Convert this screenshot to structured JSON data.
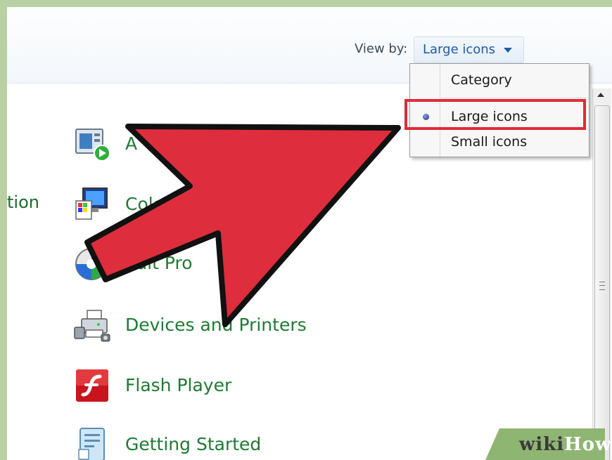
{
  "toolbar": {
    "view_by_label": "View by:",
    "view_by_value": "Large icons"
  },
  "left_partial_label": "tion",
  "items": [
    {
      "label": "A",
      "icon": "action-center-icon"
    },
    {
      "label": "Colo",
      "icon": "color-management-icon"
    },
    {
      "label": "ault Pro",
      "icon": "default-programs-icon"
    },
    {
      "label": "Devices and Printers",
      "icon": "devices-printers-icon"
    },
    {
      "label": "Flash Player",
      "icon": "flash-player-icon"
    },
    {
      "label": "Getting Started",
      "icon": "getting-started-icon"
    }
  ],
  "dropdown_menu": {
    "items": [
      {
        "label": "Category",
        "selected": false
      },
      {
        "label": "Large icons",
        "selected": true
      },
      {
        "label": "Small icons",
        "selected": false
      }
    ]
  },
  "watermark": {
    "prefix": "wiki",
    "suffix": "How"
  },
  "colors": {
    "arrow": "#de2d3c",
    "highlight": "#e02b38",
    "item_text": "#1f7a33",
    "link_text": "#1e5aa8",
    "border": "#b9cfa4"
  }
}
